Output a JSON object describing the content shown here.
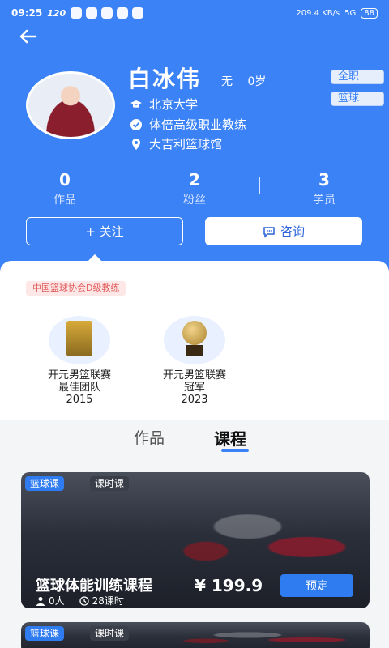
{
  "status_bar": {
    "time": "09:25",
    "network_speed": "120",
    "net_rate": "209.4 KB/s",
    "signal": "5G",
    "battery": "88"
  },
  "profile": {
    "name": "白冰伟",
    "gender": "无",
    "age": "0岁",
    "tags": [
      "全职",
      "篮球"
    ],
    "school": "北京大学",
    "title": "体倍高级职业教练",
    "venue": "大吉利篮球馆"
  },
  "stats": [
    {
      "value": "0",
      "label": "作品"
    },
    {
      "value": "2",
      "label": "粉丝"
    },
    {
      "value": "3",
      "label": "学员"
    }
  ],
  "actions": {
    "follow": "+ 关注",
    "consult": "咨询"
  },
  "certification": "中国篮球协会D级教练",
  "awards": [
    {
      "line1": "开元男篮联赛",
      "line2": "最佳团队",
      "year": "2015"
    },
    {
      "line1": "开元男篮联赛",
      "line2": "冠军",
      "year": "2023"
    }
  ],
  "tabs": [
    {
      "label": "作品"
    },
    {
      "label": "课程"
    }
  ],
  "courses": [
    {
      "tag1": "篮球课",
      "tag2": "课时课",
      "title": "篮球体能训练课程",
      "price": "¥ 199.9",
      "people": "0人",
      "sessions": "28课时",
      "action": "预定"
    },
    {
      "tag1": "篮球课",
      "tag2": "课时课"
    }
  ]
}
